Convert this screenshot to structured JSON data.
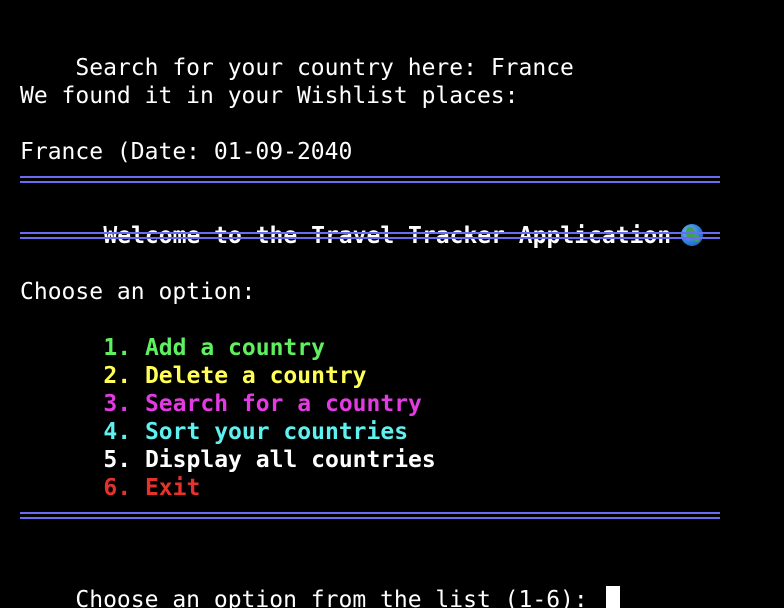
{
  "search": {
    "prompt": "Search for your country here: ",
    "value": "France"
  },
  "result": {
    "message": "We found it in your Wishlist places:",
    "entry": "France (Date: 01-09-2040"
  },
  "banner": {
    "title": "Welcome to the Travel Tracker Application",
    "icon": "globe-icon"
  },
  "menu": {
    "heading": "Choose an option:",
    "options": [
      {
        "number": "1.",
        "label": "Add a country",
        "color": "#5ff05f"
      },
      {
        "number": "2.",
        "label": "Delete a country",
        "color": "#ffff55"
      },
      {
        "number": "3.",
        "label": "Search for a country",
        "color": "#e23be2"
      },
      {
        "number": "4.",
        "label": "Sort your countries",
        "color": "#5ff0f0"
      },
      {
        "number": "5.",
        "label": "Display all countries",
        "color": "#ffffff"
      },
      {
        "number": "6.",
        "label": "Exit",
        "color": "#e5322a"
      }
    ]
  },
  "input": {
    "prompt": "Choose an option from the list (1-6): "
  },
  "colors": {
    "background": "#000000",
    "text": "#ffffff",
    "separator": "#6b6bf0"
  }
}
